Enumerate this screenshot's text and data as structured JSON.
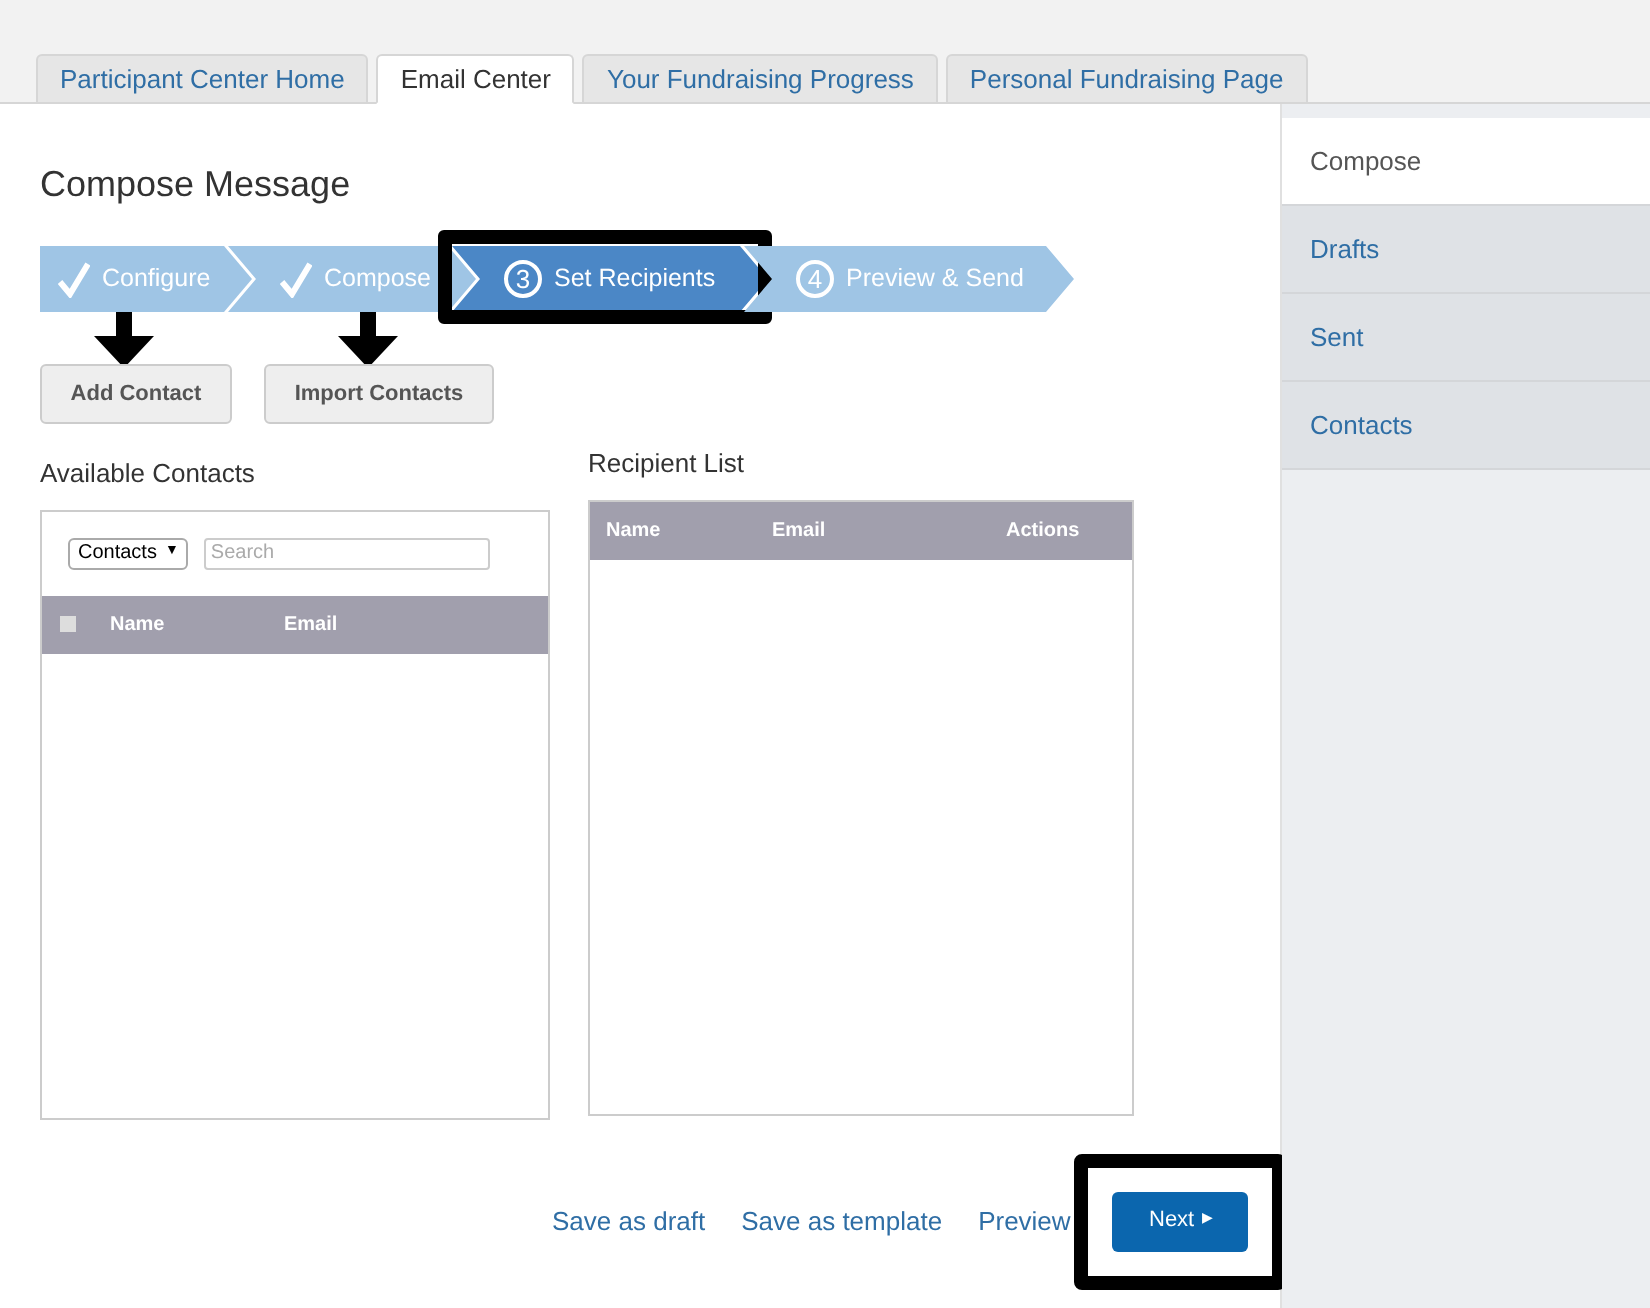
{
  "tabs": [
    {
      "label": "Participant Center Home",
      "selected": false
    },
    {
      "label": "Email Center",
      "selected": true
    },
    {
      "label": "Your Fundraising Progress",
      "selected": false
    },
    {
      "label": "Personal Fundraising Page",
      "selected": false
    }
  ],
  "title": "Compose Message",
  "steps": [
    {
      "label": "Configure",
      "completed": true,
      "selected": false,
      "highlighted": false
    },
    {
      "label": "Compose",
      "completed": true,
      "selected": false,
      "highlighted": false
    },
    {
      "number": "3",
      "label": "Set Recipients",
      "completed": false,
      "selected": true,
      "highlighted": true
    },
    {
      "number": "4",
      "label": "Preview & Send",
      "completed": false,
      "selected": false,
      "highlighted": false
    }
  ],
  "actions": [
    {
      "label": "Add Contact",
      "arrow": true
    },
    {
      "label": "Import Contacts",
      "arrow": true
    }
  ],
  "available_contacts": {
    "title": "Available Contacts",
    "filter": "Contacts",
    "filter_caret": "▼",
    "select_all": {
      "checked": false
    },
    "search": {
      "placeholder": "Search"
    },
    "columns": [
      "Name",
      "Email"
    ]
  },
  "recipient_list": {
    "title": "Recipient List",
    "columns": [
      "Name",
      "Email",
      "Actions"
    ]
  },
  "footer_links": [
    "Save as draft",
    "Save as template",
    "Preview"
  ],
  "next_button": {
    "label": "Next",
    "caret": "▶",
    "highlighted": true
  },
  "sidebar": {
    "items": [
      {
        "label": "Compose",
        "selected": true
      },
      {
        "label": "Drafts",
        "selected": false
      },
      {
        "label": "Sent",
        "selected": false
      },
      {
        "label": "Contacts",
        "selected": false
      }
    ]
  }
}
